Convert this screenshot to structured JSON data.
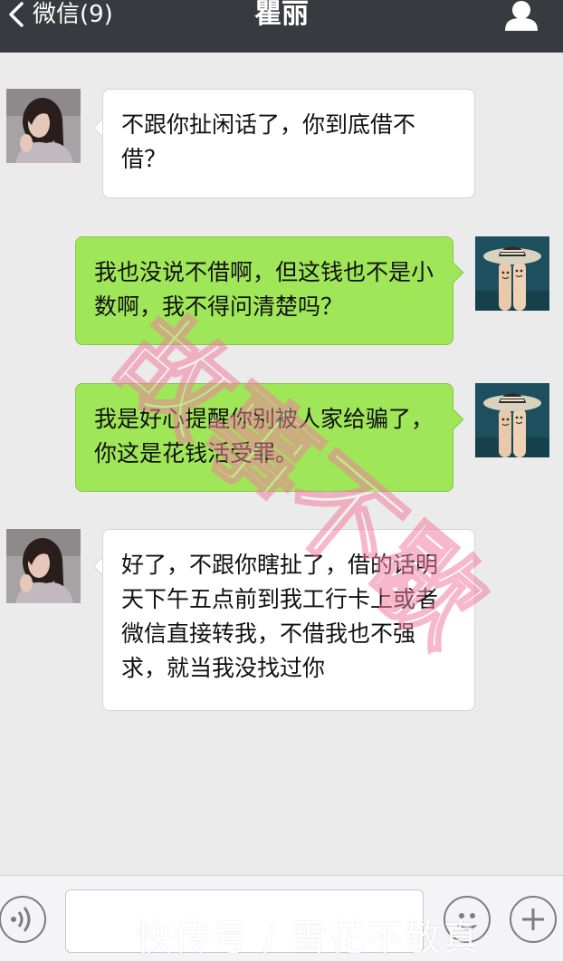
{
  "header": {
    "back_label": "微信(9)",
    "title": "瞿丽",
    "profile_icon": "person-icon"
  },
  "messages": [
    {
      "side": "left",
      "text": "不跟你扯闲话了，你到底借不借？"
    },
    {
      "side": "right",
      "text": "我也没说不借啊，但这钱也不是小数啊，我不得问清楚吗？"
    },
    {
      "side": "right",
      "text": "我是好心提醒你别被人家给骗了，你这是花钱活受罪。"
    },
    {
      "side": "left",
      "text": "好了，不跟你瞎扯了，借的话明天下午五点前到我工行卡上或者微信直接转我，不借我也不强求，就当我没找过你"
    }
  ],
  "watermark": "故事不歇",
  "bottom_watermark": "快传号 / 雪花不敬真",
  "colors": {
    "header_bg": "#393a3f",
    "chat_bg": "#ebebeb",
    "right_bubble": "#9fe658",
    "left_bubble": "#ffffff"
  }
}
